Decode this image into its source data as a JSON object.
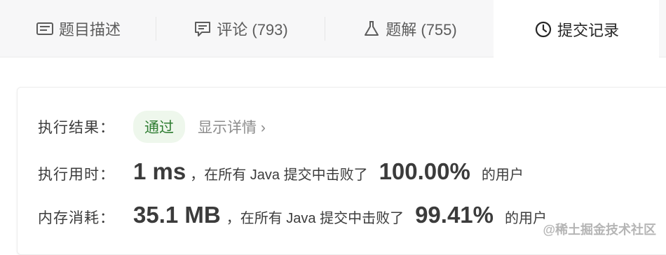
{
  "tabs": [
    {
      "label": "题目描述",
      "icon": "description-icon"
    },
    {
      "label": "评论 (793)",
      "icon": "comment-icon"
    },
    {
      "label": "题解 (755)",
      "icon": "flask-icon"
    },
    {
      "label": "提交记录",
      "icon": "clock-icon"
    }
  ],
  "result": {
    "label": "执行结果：",
    "status": "通过",
    "detail_link": "显示详情 ›"
  },
  "runtime": {
    "label": "执行用时：",
    "value": "1 ms",
    "mid_text": "，在所有 Java 提交中击败了",
    "percent": "100.00%",
    "suffix": "的用户"
  },
  "memory": {
    "label": "内存消耗：",
    "value": "35.1 MB",
    "mid_text": "，在所有 Java 提交中击败了",
    "percent": "99.41%",
    "suffix": "的用户"
  },
  "watermark": "@稀土掘金技术社区",
  "colors": {
    "tabbar_bg": "#f7f7f8",
    "pass_bg": "#eef7ec",
    "pass_text": "#2f7d32"
  }
}
